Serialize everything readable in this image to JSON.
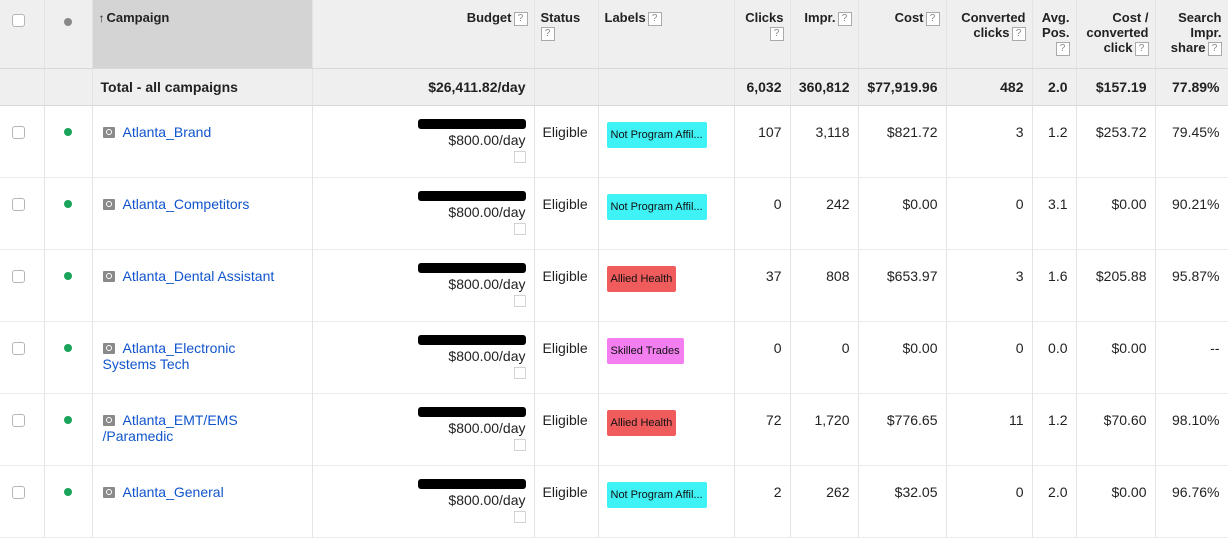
{
  "colors": {
    "label_cyan": "#3ff2f5",
    "label_red": "#f05c5c",
    "label_pink": "#f27ef0",
    "status_dot": "#1aa35a",
    "link": "#1155cc"
  },
  "header": {
    "sort_arrow": "↑",
    "campaign": "Campaign",
    "budget": "Budget",
    "status": "Status",
    "labels": "Labels",
    "clicks": "Clicks",
    "impr": "Impr.",
    "cost": "Cost",
    "converted_l1": "Converted",
    "converted_l2": "clicks",
    "avg_l1": "Avg.",
    "avg_l2": "Pos.",
    "cpc_l1": "Cost /",
    "cpc_l2": "converted",
    "cpc_l3": "click",
    "sis_l1": "Search",
    "sis_l2": "Impr.",
    "sis_l3": "share",
    "help": "?"
  },
  "total": {
    "label": "Total - all campaigns",
    "budget": "$26,411.82/day",
    "clicks": "6,032",
    "impr": "360,812",
    "cost": "$77,919.96",
    "converted": "482",
    "avg_pos": "2.0",
    "cost_conv": "$157.19",
    "sis": "77.89%"
  },
  "rows": [
    {
      "name_l1": "Atlanta_Brand",
      "name_l2": "",
      "budget": "$800.00/day",
      "status": "Eligible",
      "label": "Not Program Affil...",
      "label_color": "#3ff2f5",
      "clicks": "107",
      "impr": "3,118",
      "cost": "$821.72",
      "converted": "3",
      "avg_pos": "1.2",
      "cost_conv": "$253.72",
      "sis": "79.45%"
    },
    {
      "name_l1": "Atlanta_Competitors",
      "name_l2": "",
      "budget": "$800.00/day",
      "status": "Eligible",
      "label": "Not Program Affil...",
      "label_color": "#3ff2f5",
      "clicks": "0",
      "impr": "242",
      "cost": "$0.00",
      "converted": "0",
      "avg_pos": "3.1",
      "cost_conv": "$0.00",
      "sis": "90.21%"
    },
    {
      "name_l1": "Atlanta_Dental Assistant",
      "name_l2": "",
      "budget": "$800.00/day",
      "status": "Eligible",
      "label": "Allied Health",
      "label_color": "#f05c5c",
      "clicks": "37",
      "impr": "808",
      "cost": "$653.97",
      "converted": "3",
      "avg_pos": "1.6",
      "cost_conv": "$205.88",
      "sis": "95.87%"
    },
    {
      "name_l1": "Atlanta_Electronic",
      "name_l2": "Systems Tech",
      "budget": "$800.00/day",
      "status": "Eligible",
      "label": "Skilled Trades",
      "label_color": "#f27ef0",
      "clicks": "0",
      "impr": "0",
      "cost": "$0.00",
      "converted": "0",
      "avg_pos": "0.0",
      "cost_conv": "$0.00",
      "sis": "--"
    },
    {
      "name_l1": "Atlanta_EMT/EMS",
      "name_l2": "/Paramedic",
      "budget": "$800.00/day",
      "status": "Eligible",
      "label": "Allied Health",
      "label_color": "#f05c5c",
      "clicks": "72",
      "impr": "1,720",
      "cost": "$776.65",
      "converted": "11",
      "avg_pos": "1.2",
      "cost_conv": "$70.60",
      "sis": "98.10%"
    },
    {
      "name_l1": "Atlanta_General",
      "name_l2": "",
      "budget": "$800.00/day",
      "status": "Eligible",
      "label": "Not Program Affil...",
      "label_color": "#3ff2f5",
      "clicks": "2",
      "impr": "262",
      "cost": "$32.05",
      "converted": "0",
      "avg_pos": "2.0",
      "cost_conv": "$0.00",
      "sis": "96.76%"
    }
  ]
}
